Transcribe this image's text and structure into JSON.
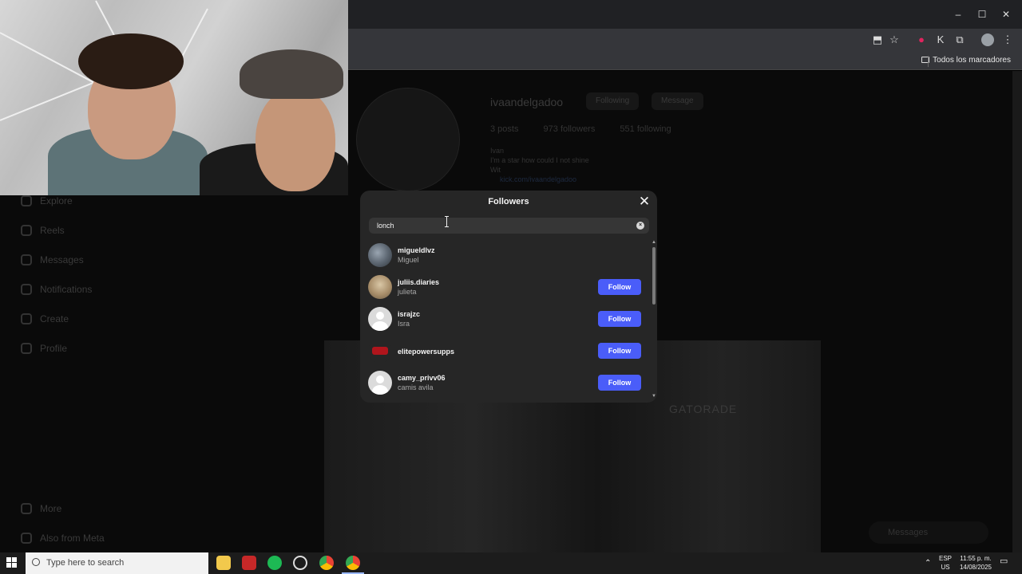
{
  "browser": {
    "bookmarks_folder": "Todos los marcadores",
    "controls": {
      "minimize": "–",
      "maximize": "☐",
      "close": "✕"
    }
  },
  "instagram_bg": {
    "nav": [
      "Explore",
      "Reels",
      "Messages",
      "Notifications",
      "Create",
      "Profile",
      "More",
      "Also from Meta"
    ],
    "profile": {
      "username": "ivaandelgadoo",
      "following_btn": "Following",
      "message_btn": "Message",
      "stats": [
        "3 posts",
        "973 followers",
        "551 following"
      ],
      "bio": [
        "Ivan",
        "I'm a star how could I not shine",
        "Wit"
      ],
      "link": "kick.com/ivaandelgadoo"
    },
    "post_tag": "GATORADE",
    "messages_pill": "Messages"
  },
  "modal": {
    "title": "Followers",
    "search": {
      "value": "lonch"
    },
    "clear_icon": "×",
    "close_icon": "✕",
    "follow_label": "Follow",
    "followers": [
      {
        "username": "migueldlvz",
        "full_name": "Miguel",
        "avatar": "photo",
        "show_follow": false
      },
      {
        "username": "juliis.diaries",
        "full_name": "julieta",
        "avatar": "photo",
        "show_follow": true
      },
      {
        "username": "israjzc",
        "full_name": "Isra",
        "avatar": "default",
        "show_follow": true
      },
      {
        "username": "elitepowersupps",
        "full_name": "",
        "avatar": "logo",
        "show_follow": true
      },
      {
        "username": "camy_privv06",
        "full_name": "camis avila",
        "avatar": "default",
        "show_follow": true
      }
    ]
  },
  "taskbar": {
    "search_placeholder": "Type here to search",
    "lang_top": "ESP",
    "lang_bottom": "US",
    "time": "11:55 p. m.",
    "date": "14/08/2025"
  },
  "colors": {
    "follow_button": "#4a5df9",
    "modal_bg": "#262626"
  }
}
